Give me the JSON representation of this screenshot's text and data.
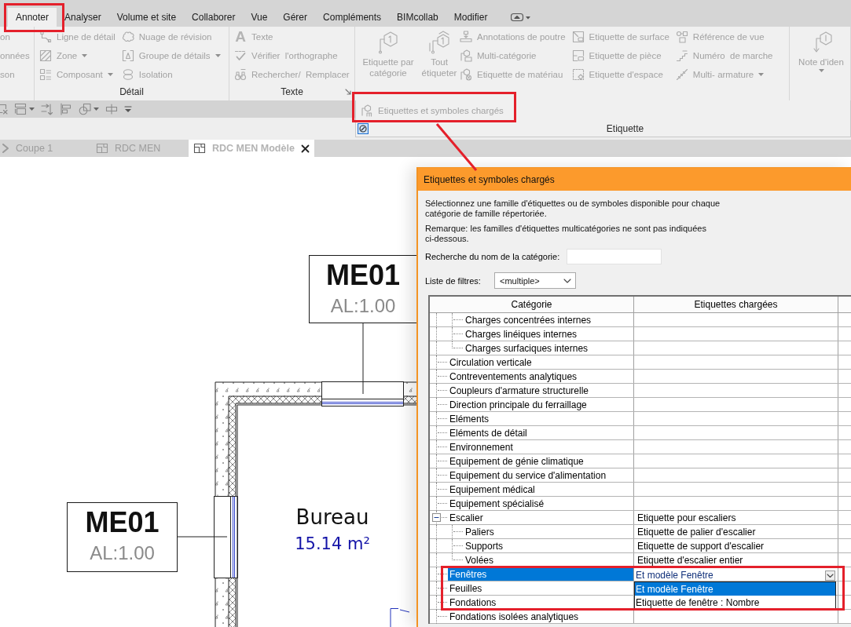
{
  "ribbon_tabs": [
    {
      "label": "Annoter",
      "selected": true
    },
    {
      "label": "Analyser",
      "selected": false
    },
    {
      "label": "Volume et site",
      "selected": false
    },
    {
      "label": "Collaborer",
      "selected": false
    },
    {
      "label": "Vue",
      "selected": false
    },
    {
      "label": "Gérer",
      "selected": false
    },
    {
      "label": "Compléments",
      "selected": false
    },
    {
      "label": "BIMcollab",
      "selected": false
    },
    {
      "label": "Modifier",
      "selected": false
    }
  ],
  "ribbon": {
    "disabled": true,
    "panels": [
      {
        "columns": [
          [
            {
              "label": "on"
            },
            {
              "label": "onnées"
            },
            {
              "label": "son"
            }
          ]
        ]
      },
      {
        "title": "Détail",
        "columns": [
          [
            {
              "label": "Ligne de détail",
              "dropdown": false
            },
            {
              "label": "Zone",
              "dropdown": true
            },
            {
              "label": "Composant",
              "dropdown": true
            }
          ],
          [
            {
              "label": "Nuage de révision",
              "dropdown": false
            },
            {
              "label": "Groupe de détails",
              "dropdown": true
            },
            {
              "label": "Isolation",
              "dropdown": false
            }
          ]
        ]
      },
      {
        "title": "Texte",
        "launcher": true,
        "columns": [
          [
            {
              "label": "Texte",
              "glyph": "A",
              "dropdown": false
            },
            {
              "label": "Vérifier  l'orthographe",
              "dropdown": false
            },
            {
              "label": "Rechercher/  Remplacer",
              "dropdown": false
            }
          ]
        ]
      },
      {
        "title": "Etiquette",
        "expanded": true,
        "large": [
          {
            "label": "Etiquette par catégorie",
            "dropdown": false
          },
          {
            "label": "Tout étiqueter",
            "dropdown": false
          }
        ],
        "columns": [
          [
            {
              "label": "Annotations de poutre",
              "dropdown": false
            },
            {
              "label": "Multi-catégorie",
              "dropdown": false
            },
            {
              "label": "Etiquette de matériau",
              "dropdown": false
            }
          ],
          [
            {
              "label": "Etiquette de surface",
              "dropdown": false
            },
            {
              "label": "Etiquette de pièce",
              "dropdown": false
            },
            {
              "label": "Etiquette d'espace",
              "dropdown": false
            }
          ],
          [
            {
              "label": "Référence de vue",
              "dropdown": false
            },
            {
              "label": "Numéro  de marche",
              "dropdown": false
            },
            {
              "label": "Multi- armature",
              "dropdown": true
            }
          ]
        ],
        "slideout": [
          {
            "label": "Etiquettes et symboles chargés"
          }
        ]
      },
      {
        "large": [
          {
            "label": "Note d'iden",
            "dropdown": true
          }
        ]
      }
    ]
  },
  "view_tabs": [
    {
      "label": "Coupe 1",
      "selected": false
    },
    {
      "label": "RDC MEN",
      "selected": false
    },
    {
      "label": "RDC MEN Modèle",
      "selected": true
    }
  ],
  "drawing": {
    "window_tags": [
      {
        "mark": "ME01",
        "label": "AL:1.00"
      },
      {
        "mark": "ME01",
        "label": "AL:1.00"
      }
    ],
    "room": {
      "name": "Bureau",
      "area": "15.14 m²"
    }
  },
  "dialog": {
    "title": "Etiquettes et symboles chargés",
    "description": "Sélectionnez une famille d'étiquettes ou de symboles disponible pour chaque catégorie de famille répertoriée.",
    "note": "Remarque: les familles d'étiquettes multicatégories ne sont pas indiquées ci-dessous.",
    "search": {
      "label": "Recherche du nom de la catégorie:"
    },
    "filter": {
      "label": "Liste de filtres:",
      "value": "<multiple>"
    },
    "table": {
      "columns": [
        "Catégorie",
        "Etiquettes chargées"
      ],
      "rows": [
        {
          "children": [
            {
              "category": "Charges concentrées internes",
              "selected": false
            },
            {
              "category": "Charges linéiques internes",
              "selected": false
            },
            {
              "category": "Charges surfaciques internes",
              "selected": false
            }
          ]
        },
        {
          "category": "Circulation verticale",
          "selected": false
        },
        {
          "category": "Contreventements analytiques",
          "selected": false
        },
        {
          "category": "Coupleurs d'armature structurelle",
          "selected": false
        },
        {
          "category": "Direction principale du ferraillage",
          "selected": false
        },
        {
          "category": "Eléments",
          "selected": false
        },
        {
          "category": "Eléments de détail",
          "selected": false
        },
        {
          "category": "Environnement",
          "selected": false
        },
        {
          "category": "Equipement de génie climatique",
          "selected": false
        },
        {
          "category": "Equipement du service d'alimentation",
          "selected": false
        },
        {
          "category": "Equipement médical",
          "selected": false
        },
        {
          "category": "Equipement spécialisé",
          "selected": false
        },
        {
          "category": "Escalier",
          "tag": "Etiquette pour escaliers",
          "selected": false,
          "expanded": true,
          "children": [
            {
              "category": "Paliers",
              "tag": "Etiquette de palier d'escalier",
              "selected": false
            },
            {
              "category": "Supports",
              "tag": "Etiquette de support d'escalier",
              "selected": false
            },
            {
              "category": "Volées",
              "tag": "Etiquette d'escalier entier",
              "selected": false
            }
          ]
        },
        {
          "category": "Fenêtres",
          "tag": "Et modèle Fenêtre",
          "selected": true,
          "editor": {
            "open": true,
            "options": [
              {
                "label": "Et modèle Fenêtre",
                "selected": true
              },
              {
                "label": "Etiquette de fenêtre : Nombre",
                "selected": false
              }
            ]
          }
        },
        {
          "category": "Feuilles",
          "selected": false
        },
        {
          "category": "Fondations",
          "selected": false
        },
        {
          "category": "Fondations isolées analytiques",
          "selected": false
        }
      ]
    }
  }
}
